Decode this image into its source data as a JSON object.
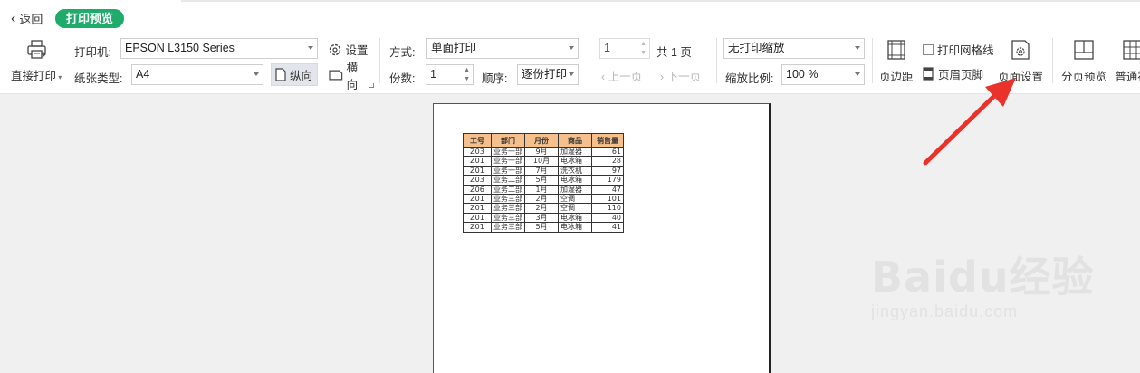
{
  "header": {
    "back_label": "返回",
    "title_pill": "打印预览"
  },
  "printer": {
    "direct_print_label": "直接打印",
    "printer_label": "打印机:",
    "printer_value": "EPSON L3150 Series",
    "settings_label": "设置",
    "paper_label": "纸张类型:",
    "paper_value": "A4",
    "portrait_label": "纵向",
    "landscape_label": "横向"
  },
  "mode": {
    "method_label": "方式:",
    "method_value": "单面打印",
    "copies_label": "份数:",
    "copies_value": "1",
    "order_label": "顺序:",
    "order_value": "逐份打印"
  },
  "paging": {
    "page_value": "1",
    "total_label": "共 1 页",
    "prev_label": "上一页",
    "next_label": "下一页"
  },
  "scale": {
    "mode_value": "无打印缩放",
    "ratio_label": "缩放比例:",
    "ratio_value": "100 %"
  },
  "tools": {
    "margins_label": "页边距",
    "grid_label": "打印网格线",
    "header_footer_label": "页眉页脚",
    "page_setup_label": "页面设置",
    "page_break_label": "分页预览",
    "normal_label": "普通视"
  },
  "sheet": {
    "headers": [
      "工号",
      "部门",
      "月份",
      "商品",
      "销售量"
    ],
    "rows": [
      [
        "Z03",
        "业务一部",
        "9月",
        "加湿器",
        "61"
      ],
      [
        "Z01",
        "业务一部",
        "10月",
        "电冰箱",
        "28"
      ],
      [
        "Z01",
        "业务一部",
        "7月",
        "洗衣机",
        "97"
      ],
      [
        "Z03",
        "业务二部",
        "5月",
        "电冰箱",
        "179"
      ],
      [
        "Z06",
        "业务二部",
        "1月",
        "加湿器",
        "47"
      ],
      [
        "Z01",
        "业务三部",
        "2月",
        "空调",
        "101"
      ],
      [
        "Z01",
        "业务三部",
        "2月",
        "空调",
        "110"
      ],
      [
        "Z01",
        "业务三部",
        "3月",
        "电冰箱",
        "40"
      ],
      [
        "Z01",
        "业务三部",
        "5月",
        "电冰箱",
        "41"
      ]
    ]
  },
  "watermark": {
    "brand": "Baidu经验",
    "url": "jingyan.baidu.com"
  },
  "colors": {
    "accent_green": "#1fab6b",
    "header_fill": "#f5c08c",
    "arrow_red": "#e8322a"
  }
}
